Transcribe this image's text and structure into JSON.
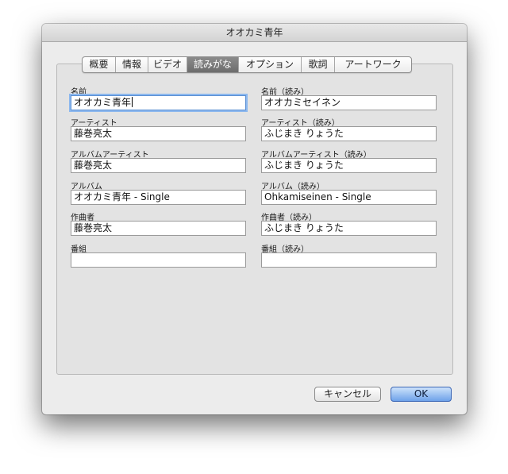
{
  "window": {
    "title": "オオカミ青年"
  },
  "tabs": [
    {
      "label": "概要"
    },
    {
      "label": "情報"
    },
    {
      "label": "ビデオ"
    },
    {
      "label": "読みがな",
      "active": true
    },
    {
      "label": "オプション"
    },
    {
      "label": "歌詞"
    },
    {
      "label": "アートワーク"
    }
  ],
  "fields": {
    "name": {
      "label": "名前",
      "value": "オオカミ青年"
    },
    "name_reading": {
      "label": "名前（読み）",
      "value": "オオカミセイネン"
    },
    "artist": {
      "label": "アーティスト",
      "value": "藤巻亮太"
    },
    "artist_reading": {
      "label": "アーティスト（読み）",
      "value": "ふじまき りょうた"
    },
    "album_artist": {
      "label": "アルバムアーティスト",
      "value": "藤巻亮太"
    },
    "album_artist_reading": {
      "label": "アルバムアーティスト（読み）",
      "value": "ふじまき りょうた"
    },
    "album": {
      "label": "アルバム",
      "value": "オオカミ青年 - Single"
    },
    "album_reading": {
      "label": "アルバム（読み）",
      "value": "Ohkamiseinen - Single"
    },
    "composer": {
      "label": "作曲者",
      "value": "藤巻亮太"
    },
    "composer_reading": {
      "label": "作曲者（読み）",
      "value": "ふじまき りょうた"
    },
    "show": {
      "label": "番組",
      "value": ""
    },
    "show_reading": {
      "label": "番組（読み）",
      "value": ""
    }
  },
  "buttons": {
    "cancel": "キャンセル",
    "ok": "OK"
  },
  "colors": {
    "accent": "#6ea2ea",
    "focus_ring": "#8db8ee"
  }
}
